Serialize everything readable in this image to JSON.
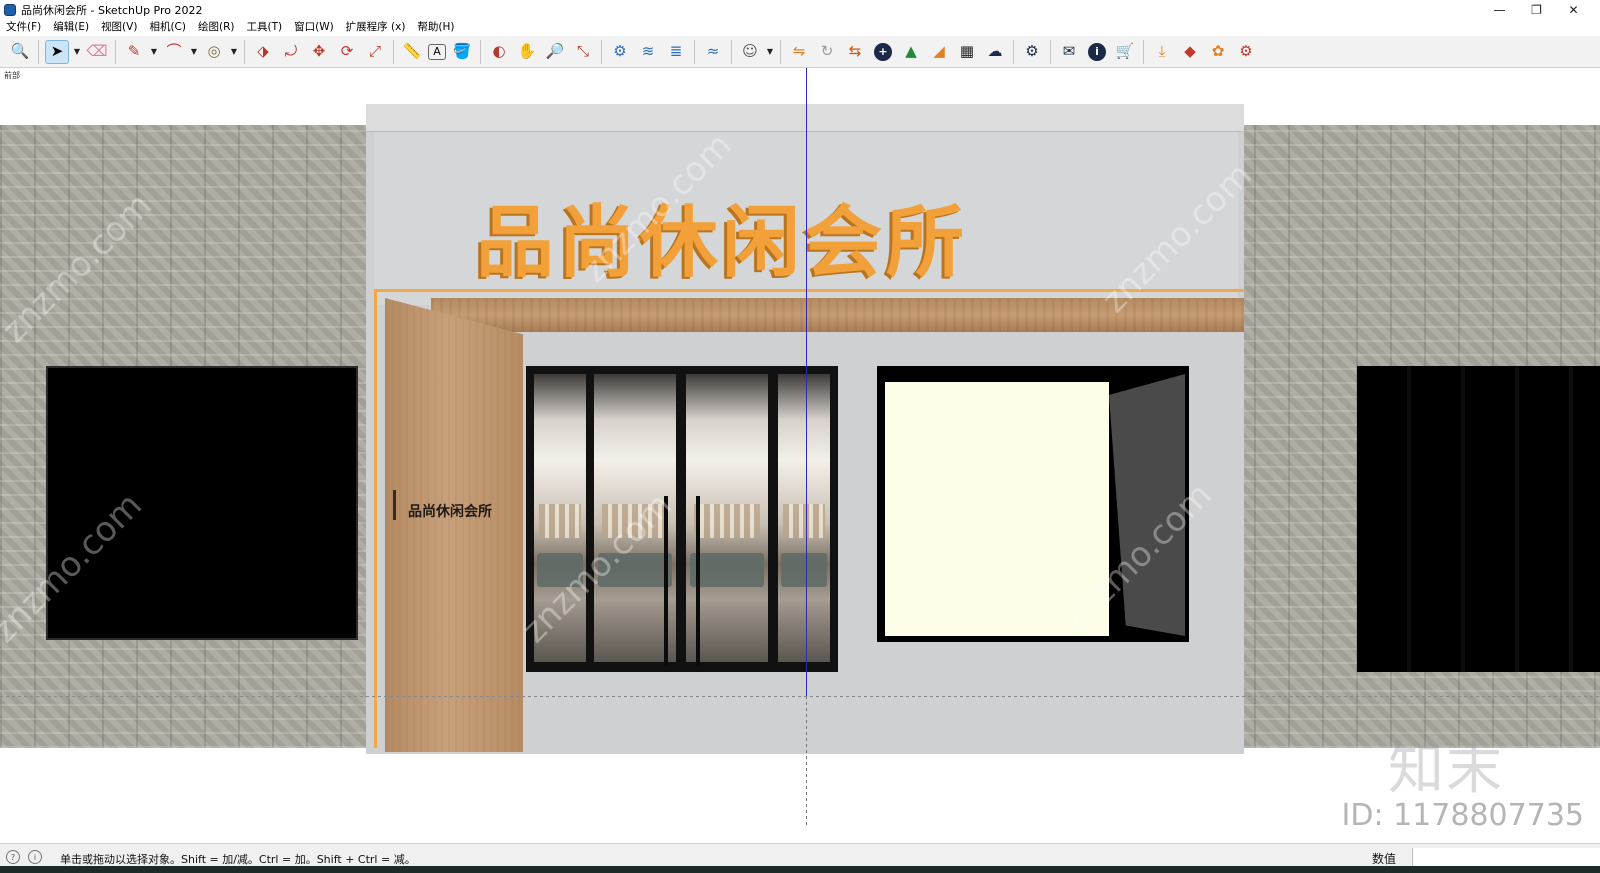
{
  "window": {
    "title": "品尚休闲会所 - SketchUp Pro 2022",
    "controls": {
      "minimize": "—",
      "maximize": "❐",
      "close": "✕"
    }
  },
  "menu": [
    "文件(F)",
    "编辑(E)",
    "视图(V)",
    "相机(C)",
    "绘图(R)",
    "工具(T)",
    "窗口(W)",
    "扩展程序 (x)",
    "帮助(H)"
  ],
  "toolbar": {
    "tools": [
      {
        "icon": "zoom-icon",
        "glyph": "🔍"
      },
      {
        "icon": "select-icon",
        "glyph": "➤"
      },
      {
        "icon": "eraser-icon",
        "glyph": "⌫"
      },
      {
        "icon": "pencil-icon",
        "glyph": "✎"
      },
      {
        "icon": "arc-icon",
        "glyph": "⌒"
      },
      {
        "icon": "shape-icon",
        "glyph": "◎"
      },
      {
        "icon": "push-pull-icon",
        "glyph": "⬗"
      },
      {
        "icon": "follow-me-icon",
        "glyph": "⤾"
      },
      {
        "icon": "move-icon",
        "glyph": "✥"
      },
      {
        "icon": "rotate-icon",
        "glyph": "⟳"
      },
      {
        "icon": "scale-icon",
        "glyph": "⤢"
      },
      {
        "icon": "tape-measure-icon",
        "glyph": "📏"
      },
      {
        "icon": "text-icon",
        "glyph": "A"
      },
      {
        "icon": "paint-bucket-icon",
        "glyph": "🪣"
      },
      {
        "icon": "orbit-icon",
        "glyph": "◐"
      },
      {
        "icon": "pan-icon",
        "glyph": "✋"
      },
      {
        "icon": "zoom-window-icon",
        "glyph": "🔎"
      },
      {
        "icon": "zoom-extents-icon",
        "glyph": "⤡"
      },
      {
        "icon": "components-icon",
        "glyph": "⚙"
      },
      {
        "icon": "sandbox-icon",
        "glyph": "≋"
      },
      {
        "icon": "layers-icon",
        "glyph": "≣"
      },
      {
        "icon": "styles-icon",
        "glyph": "≈"
      },
      {
        "icon": "account-icon",
        "glyph": "☺"
      },
      {
        "icon": "extension-warehouse-icon",
        "glyph": "⇋"
      },
      {
        "icon": "sync-icon",
        "glyph": "↻"
      },
      {
        "icon": "export-icon",
        "glyph": "⇆"
      },
      {
        "icon": "add-icon",
        "glyph": "+"
      },
      {
        "icon": "tree-icon",
        "glyph": "▲"
      },
      {
        "icon": "terrain-icon",
        "glyph": "◢"
      },
      {
        "icon": "checker-icon",
        "glyph": "▦"
      },
      {
        "icon": "cloud-upload-icon",
        "glyph": "☁"
      },
      {
        "icon": "settings-icon",
        "glyph": "⚙"
      },
      {
        "icon": "mail-icon",
        "glyph": "✉"
      },
      {
        "icon": "info-icon",
        "glyph": "i"
      },
      {
        "icon": "cart-icon",
        "glyph": "🛒"
      },
      {
        "icon": "download-icon",
        "glyph": "⤓"
      },
      {
        "icon": "plugin-icon",
        "glyph": "◆"
      },
      {
        "icon": "plugin-icon-2",
        "glyph": "✿"
      },
      {
        "icon": "plugin-settings-icon",
        "glyph": "⚙"
      }
    ]
  },
  "viewport": {
    "scene_tab": "前部",
    "sign_main": "品尚休闲会所",
    "sign_panel": "品尚休闲会所",
    "watermark_text": "znzmo.com",
    "watermark_logo": "知末",
    "watermark_id": "ID: 1178807735"
  },
  "statusbar": {
    "message": "单击或拖动以选择对象。Shift = 加/减。Ctrl = 加。Shift + Ctrl = 减。",
    "measure_label": "数值",
    "measure_value": ""
  }
}
